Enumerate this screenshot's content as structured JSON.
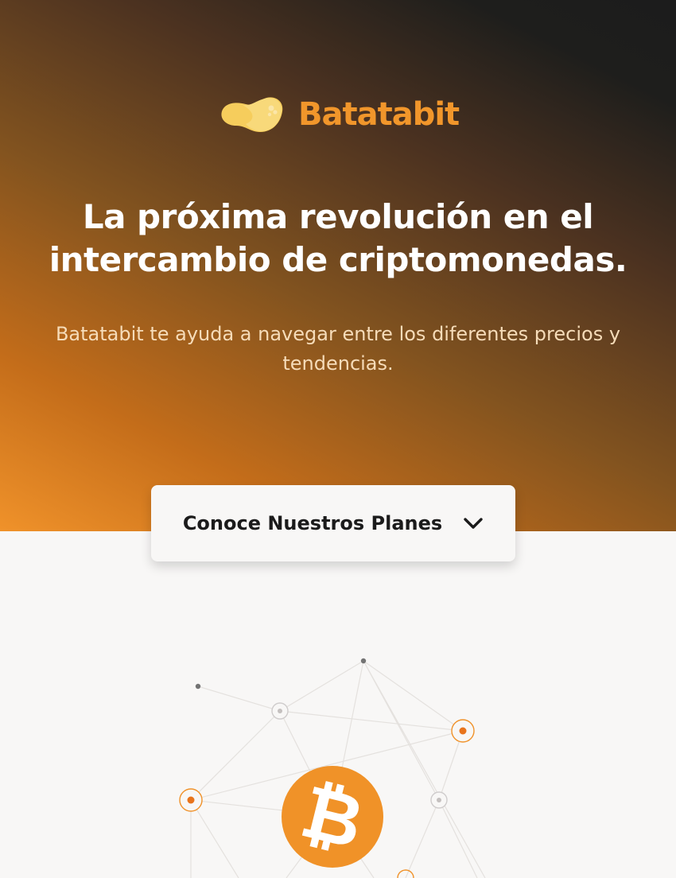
{
  "brand": {
    "name": "Batatabit",
    "logo_icon": "potato-icon",
    "color": "#f1962b"
  },
  "hero": {
    "title": "La próxima revolución en el intercambio de criptomonedas.",
    "subtitle": "Batatabit te ayuda a navegar entre los diferentes precios y tendencias."
  },
  "plans_button": {
    "label": "Conoce Nuestros Planes",
    "icon": "chevron-down-icon"
  },
  "illustration": {
    "icon": "bitcoin-icon",
    "accent_color": "#f0922a"
  }
}
